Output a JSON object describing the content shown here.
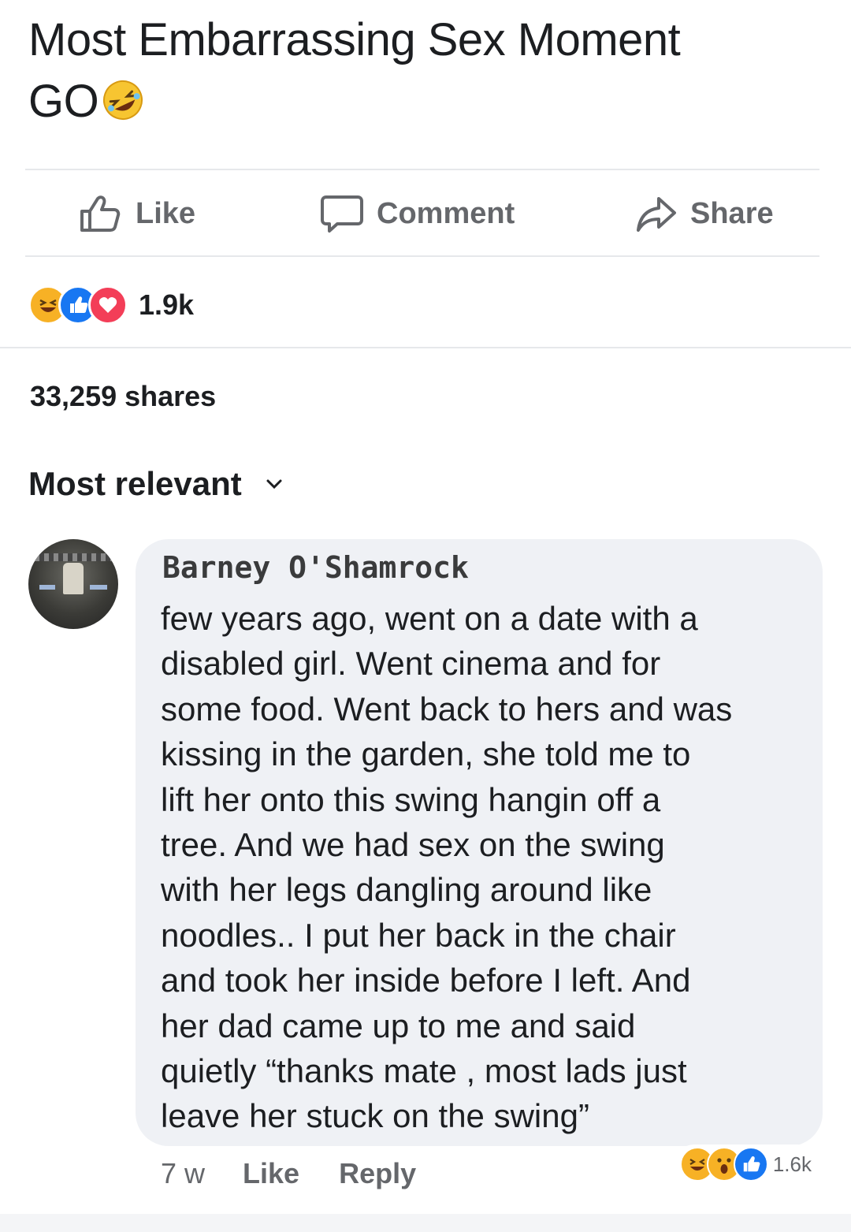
{
  "post": {
    "text_line1": "Most Embarrassing Sex Moment",
    "text_line2": "GO",
    "emoji": "rolling-on-floor-laughing-icon"
  },
  "actions": {
    "like": "Like",
    "comment": "Comment",
    "share": "Share"
  },
  "reactions": {
    "icons": [
      "haha-icon",
      "like-icon",
      "love-icon"
    ],
    "count": "1.9k"
  },
  "shares": "33,259 shares",
  "sort": {
    "label": "Most relevant"
  },
  "comment": {
    "author": "Barney O'Shamrock",
    "lines": [
      "few years ago, went on a date with a",
      "disabled girl. Went cinema and for",
      "some food. Went back to hers and was",
      "kissing in the garden, she told me to",
      "lift her onto this swing hangin off a",
      "tree. And we had sex on the swing",
      "with her legs dangling around like",
      "noodles.. I put her back in the chair",
      "and took her inside before I left. And",
      "her dad came up to me and said",
      "quietly “thanks mate , most lads just",
      "leave her stuck on the swing”"
    ],
    "time": "7 w",
    "like": "Like",
    "reply": "Reply",
    "reactions": {
      "icons": [
        "haha-icon",
        "wow-icon",
        "like-icon"
      ],
      "count": "1.6k"
    }
  },
  "colors": {
    "text": "#1c1e21",
    "secondary": "#65676b",
    "bubble": "#eff1f5",
    "like_blue": "#1877f2",
    "love_red": "#f33e58",
    "haha_yellow": "#f7b125"
  }
}
